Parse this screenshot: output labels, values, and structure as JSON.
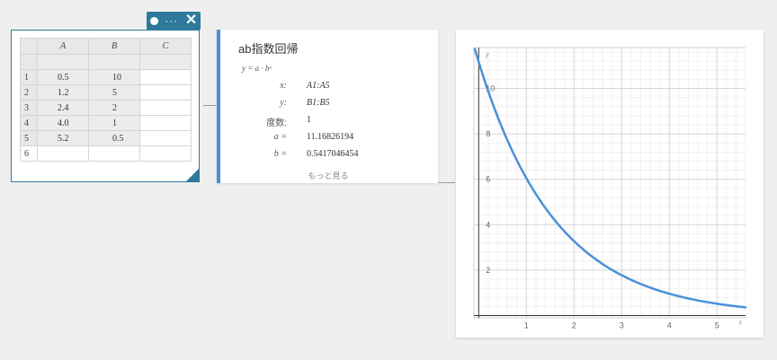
{
  "spreadsheet": {
    "columns": [
      "A",
      "B",
      "C"
    ],
    "rows": [
      {
        "num": "",
        "a": "",
        "b": "",
        "c": ""
      },
      {
        "num": "1",
        "a": "0.5",
        "b": "10",
        "c": ""
      },
      {
        "num": "2",
        "a": "1.2",
        "b": "5",
        "c": ""
      },
      {
        "num": "3",
        "a": "2.4",
        "b": "2",
        "c": ""
      },
      {
        "num": "4",
        "a": "4.0",
        "b": "1",
        "c": ""
      },
      {
        "num": "5",
        "a": "5.2",
        "b": "0.5",
        "c": ""
      },
      {
        "num": "6",
        "a": "",
        "b": "",
        "c": ""
      }
    ]
  },
  "regression": {
    "title": "ab指数回帰",
    "formula": "y = a · bˣ",
    "x_label": "x:",
    "x_value": "A1:A5",
    "y_label": "y:",
    "y_value": "B1:B5",
    "freq_label": "度数:",
    "freq_value": "1",
    "a_label": "a =",
    "a_value": "11.16826194",
    "b_label": "b =",
    "b_value": "0.5417046454",
    "more_label": "もっと見る"
  },
  "chart_data": {
    "type": "line",
    "xlabel": "x",
    "ylabel": "y",
    "xlim": [
      -0.1,
      5.6
    ],
    "ylim": [
      -0.1,
      11.8
    ],
    "x_ticks": [
      "1",
      "2",
      "3",
      "4",
      "5"
    ],
    "y_ticks": [
      "2",
      "4",
      "6",
      "8",
      "10"
    ],
    "grid": true,
    "series": [
      {
        "model": "exponential",
        "a": 11.16826194,
        "b": 0.5417046454,
        "color": "#4a90d9"
      }
    ]
  },
  "colors": {
    "accent": "#2f7a9c",
    "curve": "#4a90d9"
  }
}
